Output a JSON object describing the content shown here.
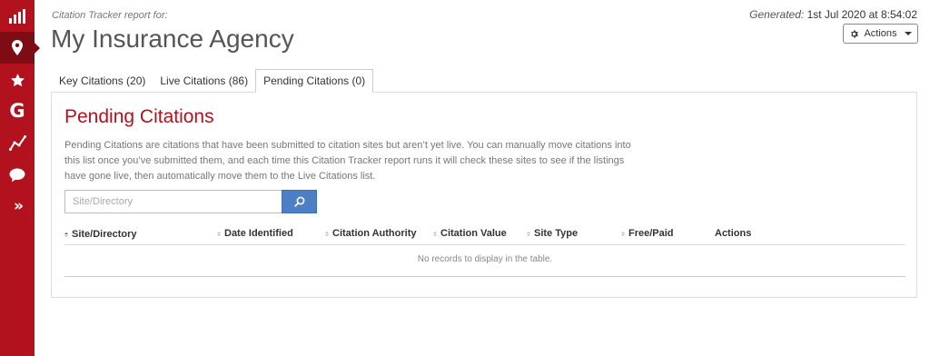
{
  "sidebar": {
    "items": [
      {
        "name": "bar-chart-icon"
      },
      {
        "name": "map-pin-icon",
        "active": true
      },
      {
        "name": "star-icon"
      },
      {
        "name": "google-icon",
        "glyph": "G"
      },
      {
        "name": "trend-line-icon"
      },
      {
        "name": "chat-bubble-icon"
      },
      {
        "name": "double-chevron-icon",
        "glyph": "»"
      }
    ]
  },
  "header": {
    "report_for": "Citation Tracker report for:",
    "title": "My Insurance Agency",
    "generated_label": "Generated:",
    "generated_value": "1st Jul 2020 at 8:54:02",
    "actions_label": "Actions"
  },
  "tabs": [
    {
      "label": "Key Citations (20)"
    },
    {
      "label": "Live Citations (86)"
    },
    {
      "label": "Pending Citations (0)",
      "active": true
    }
  ],
  "panel": {
    "title": "Pending Citations",
    "description": "Pending Citations are citations that have been submitted to citation sites but aren’t yet live. You can manually move citations into this list once you’ve submitted them, and each time this Citation Tracker report runs it will check these sites to see if the listings have gone live, then automatically move them to the Live Citations list.",
    "search_placeholder": "Site/Directory"
  },
  "table": {
    "columns": [
      "Site/Directory",
      "Date Identified",
      "Citation Authority",
      "Citation Value",
      "Site Type",
      "Free/Paid",
      "Actions"
    ],
    "empty_message": "No records to display in the table."
  },
  "colors": {
    "brand": "#b1121e",
    "brand_dark": "#7e0c15",
    "search_button": "#4d7fc4"
  }
}
